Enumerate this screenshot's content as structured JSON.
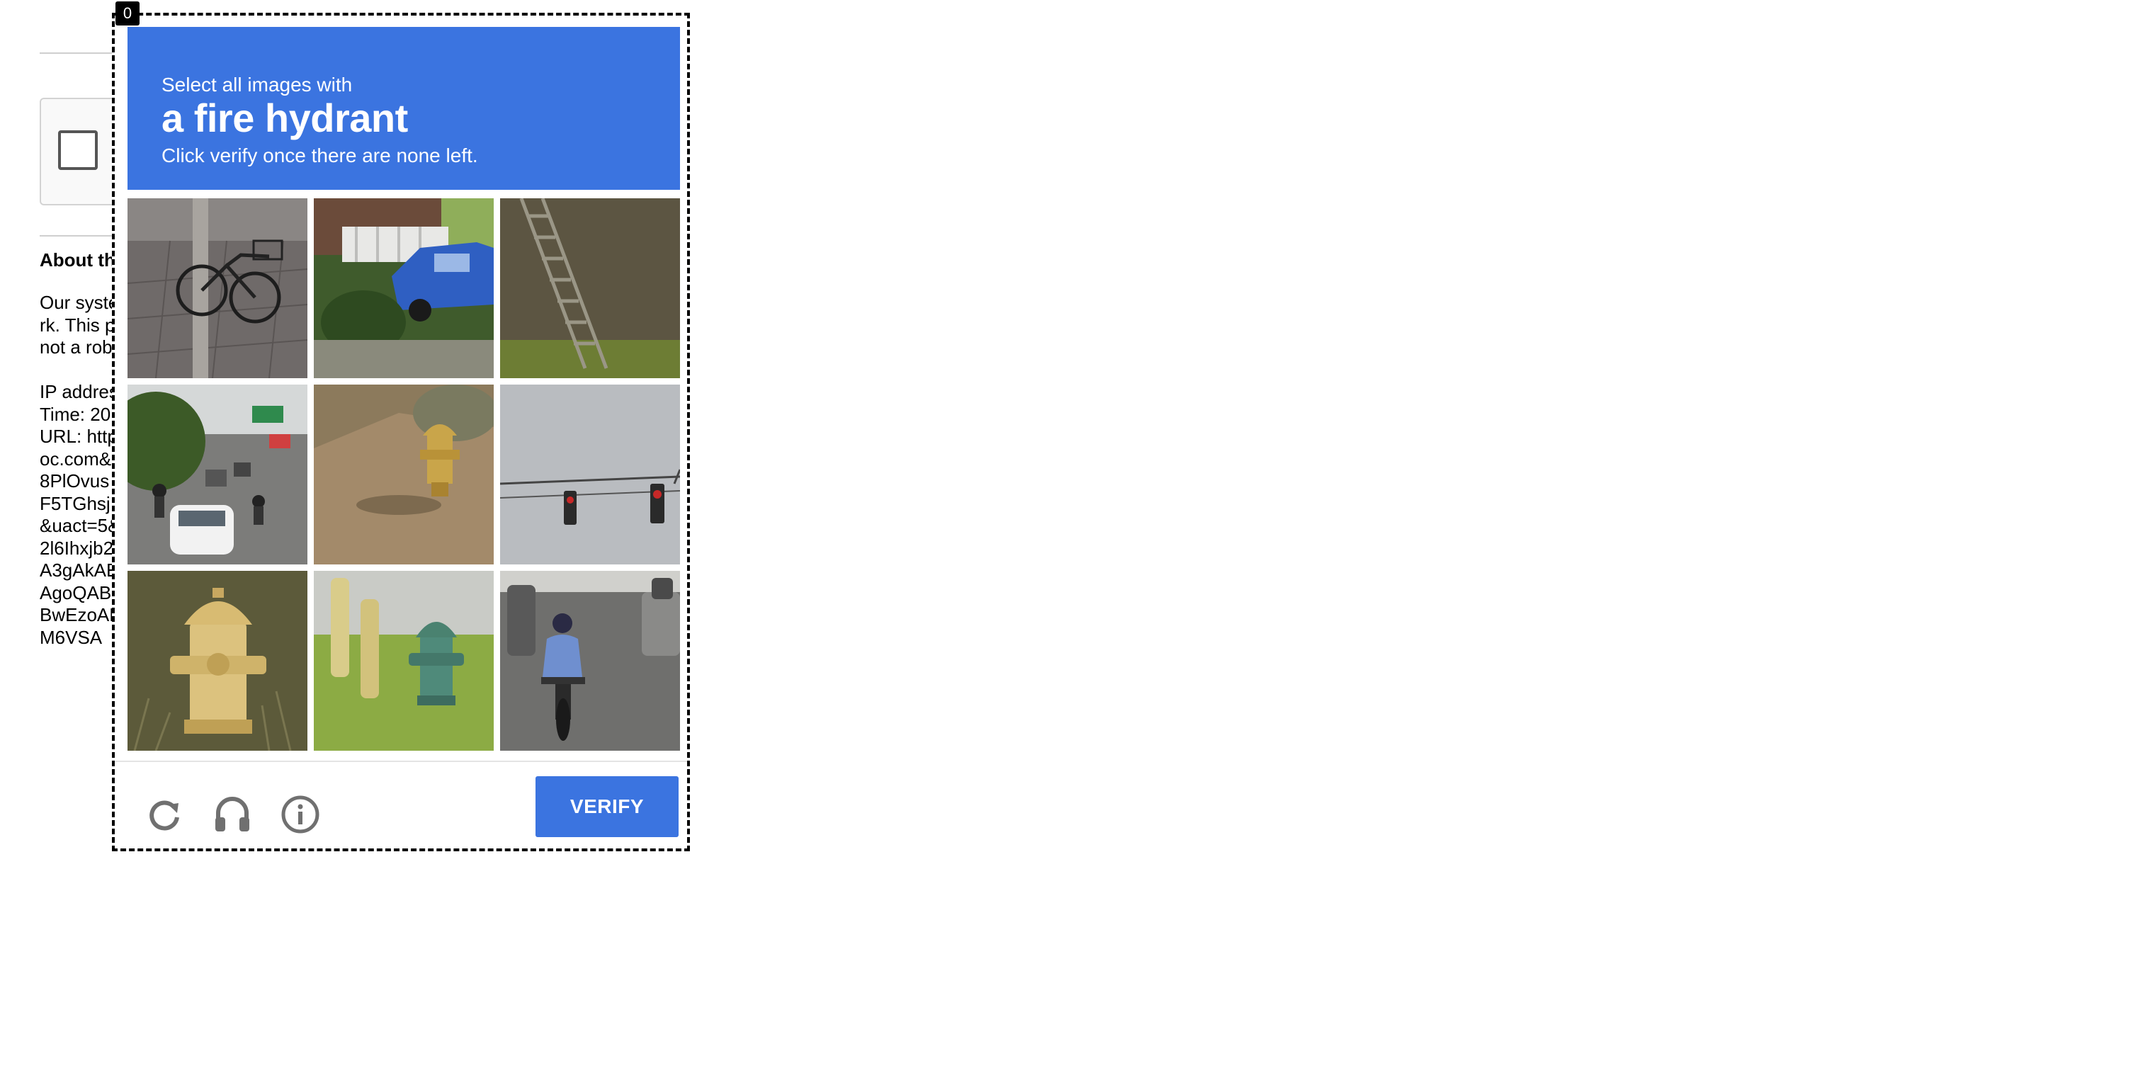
{
  "background_page": {
    "about_heading": "About th",
    "paragraph_lines": [
      "Our syste",
      "rk. This p",
      "not a rob"
    ],
    "details_lines": [
      "IP addres",
      "Time: 20",
      "URL: http",
      "oc.com&",
      "8PlOvus",
      "F5TGhsj",
      "&uact=5&",
      "2l6Ihxjb2",
      "A3gAkAE",
      "AgoQAB",
      "BwEzoAB",
      "M6VSA"
    ]
  },
  "frame_index": "0",
  "challenge": {
    "instruction_top": "Select all images with",
    "target_object": "a fire hydrant",
    "instruction_bottom": "Click verify once there are none left.",
    "tiles": [
      {
        "subject": "bicycle leaning on pole on sidewalk",
        "icon": "bicycle-tile"
      },
      {
        "subject": "blue car by white fence and bushes",
        "icon": "car-tile"
      },
      {
        "subject": "stairs on grassy hillside",
        "icon": "stairs-tile"
      },
      {
        "subject": "traffic on city road with motorbikes",
        "icon": "traffic-tile"
      },
      {
        "subject": "yellow fire hydrant on dirt roadside",
        "icon": "hydrant-tile"
      },
      {
        "subject": "traffic lights against grey sky",
        "icon": "traffic-light-tile"
      },
      {
        "subject": "yellow fire hydrant in grass",
        "icon": "hydrant-tile"
      },
      {
        "subject": "green fire hydrant by posts",
        "icon": "hydrant-tile"
      },
      {
        "subject": "motorcyclist on street with parked cars",
        "icon": "motorcycle-tile"
      }
    ],
    "footer": {
      "reload_icon": "reload-icon",
      "audio_icon": "headphones-icon",
      "info_icon": "info-icon",
      "verify_label": "VERIFY"
    },
    "colors": {
      "accent": "#3b74e0",
      "icon_gray": "#707070"
    }
  }
}
